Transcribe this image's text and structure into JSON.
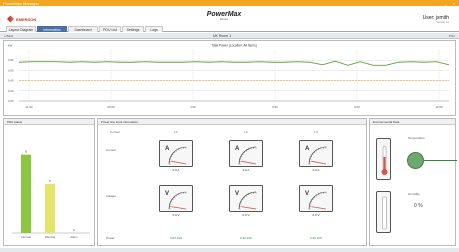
{
  "window": {
    "title": "PowerMax Manager",
    "controls": [
      "_",
      "×"
    ]
  },
  "brand": {
    "name": "EMERSON"
  },
  "product": {
    "name": "PowerMax",
    "subtitle": "Monitor"
  },
  "user": {
    "name": "User: jsmith",
    "subtitle": "Version 4.0"
  },
  "tabs": [
    {
      "label": "Layout Diagram",
      "active": false
    },
    {
      "label": "Information",
      "active": true
    },
    {
      "label": "Dashboard",
      "active": false
    },
    {
      "label": "PDU List",
      "active": false
    },
    {
      "label": "Settings",
      "active": false
    },
    {
      "label": "Logs",
      "active": false
    }
  ],
  "crumb": {
    "left": "« Back",
    "center": "UK Room 1",
    "right": "Print"
  },
  "chart_data": {
    "type": "line",
    "title": "Total Power (Location: All Items)",
    "ylabel": "kW",
    "y_ticks": [
      "0.80",
      "0.60",
      "0.40",
      "0.20",
      "0.00"
    ],
    "x_ticks": [
      "21:00",
      "00:00",
      "3:00",
      "6:00",
      "9:00",
      "12:00"
    ],
    "ylim": [
      0,
      1
    ],
    "grid": true,
    "x": [
      0,
      0.5,
      1,
      1.5,
      2,
      2.5,
      3,
      3.5,
      4,
      4.5,
      5,
      5.5,
      6,
      6.5,
      7,
      7.5,
      8,
      8.5,
      9,
      9.5,
      10,
      10.5,
      11,
      11.5,
      12,
      12.5,
      13,
      13.5,
      14,
      14.5,
      15,
      15.5,
      16,
      16.5,
      17
    ],
    "series": [
      {
        "color": "#6a9a3a",
        "values": [
          0.76,
          0.77,
          0.77,
          0.77,
          0.76,
          0.77,
          0.76,
          0.77,
          0.76,
          0.76,
          0.77,
          0.76,
          0.76,
          0.76,
          0.77,
          0.76,
          0.77,
          0.76,
          0.76,
          0.77,
          0.76,
          0.76,
          0.77,
          0.76,
          0.71,
          0.78,
          0.7,
          0.77,
          0.7,
          0.7,
          0.76,
          0.77,
          0.76,
          0.77,
          0.71
        ]
      },
      {
        "color": "#e0a000",
        "values": [
          0.4,
          0.4,
          0.4,
          0.4,
          0.4,
          0.4,
          0.4,
          0.4,
          0.4,
          0.4,
          0.4,
          0.4,
          0.4,
          0.4,
          0.4,
          0.4,
          0.4,
          0.4,
          0.4,
          0.4,
          0.4,
          0.4,
          0.4,
          0.4,
          0.4,
          0.4,
          0.4,
          0.4,
          0.4,
          0.4,
          0.4,
          0.4,
          0.4,
          0.4,
          0.4
        ]
      }
    ]
  },
  "pdu_status": {
    "title": "PDU status",
    "bars": [
      {
        "label": "Normal",
        "value": 8,
        "color": "#8dc63f"
      },
      {
        "label": "Warning",
        "value": 5,
        "color": "#e5e56b"
      },
      {
        "label": "Alarm",
        "value": 0,
        "color": "#d9534f"
      }
    ],
    "ymax": 10
  },
  "power_input": {
    "title": "Power line input information",
    "columns": [
      "L1",
      "L2",
      "L3"
    ],
    "row_labels": [
      "Current",
      "Voltage",
      "Power"
    ],
    "current": [
      {
        "unit": "A",
        "value": "0.0 A",
        "fraction": 0.12
      },
      {
        "unit": "A",
        "value": "0.0 A",
        "fraction": 0.12
      },
      {
        "unit": "A",
        "value": "0.0 A",
        "fraction": 0.12
      }
    ],
    "voltage": [
      {
        "unit": "V",
        "value": "0.0 V",
        "fraction": 0.1
      },
      {
        "unit": "V",
        "value": "0.0 V",
        "fraction": 0.1
      },
      {
        "unit": "V",
        "value": "0.0 V",
        "fraction": 0.1
      }
    ],
    "power": [
      "0.00 kVA",
      "0.00 kVA",
      "0.00 kVA"
    ]
  },
  "environment": {
    "title": "Environmental Data",
    "temp_label": "Temperature",
    "humidity_label": "Humidity",
    "humidity_value": "0 %",
    "indicator_color": "#6fa86f"
  },
  "colors": {
    "accent": "#4a6fa5",
    "titlebar": "#f4a623"
  }
}
